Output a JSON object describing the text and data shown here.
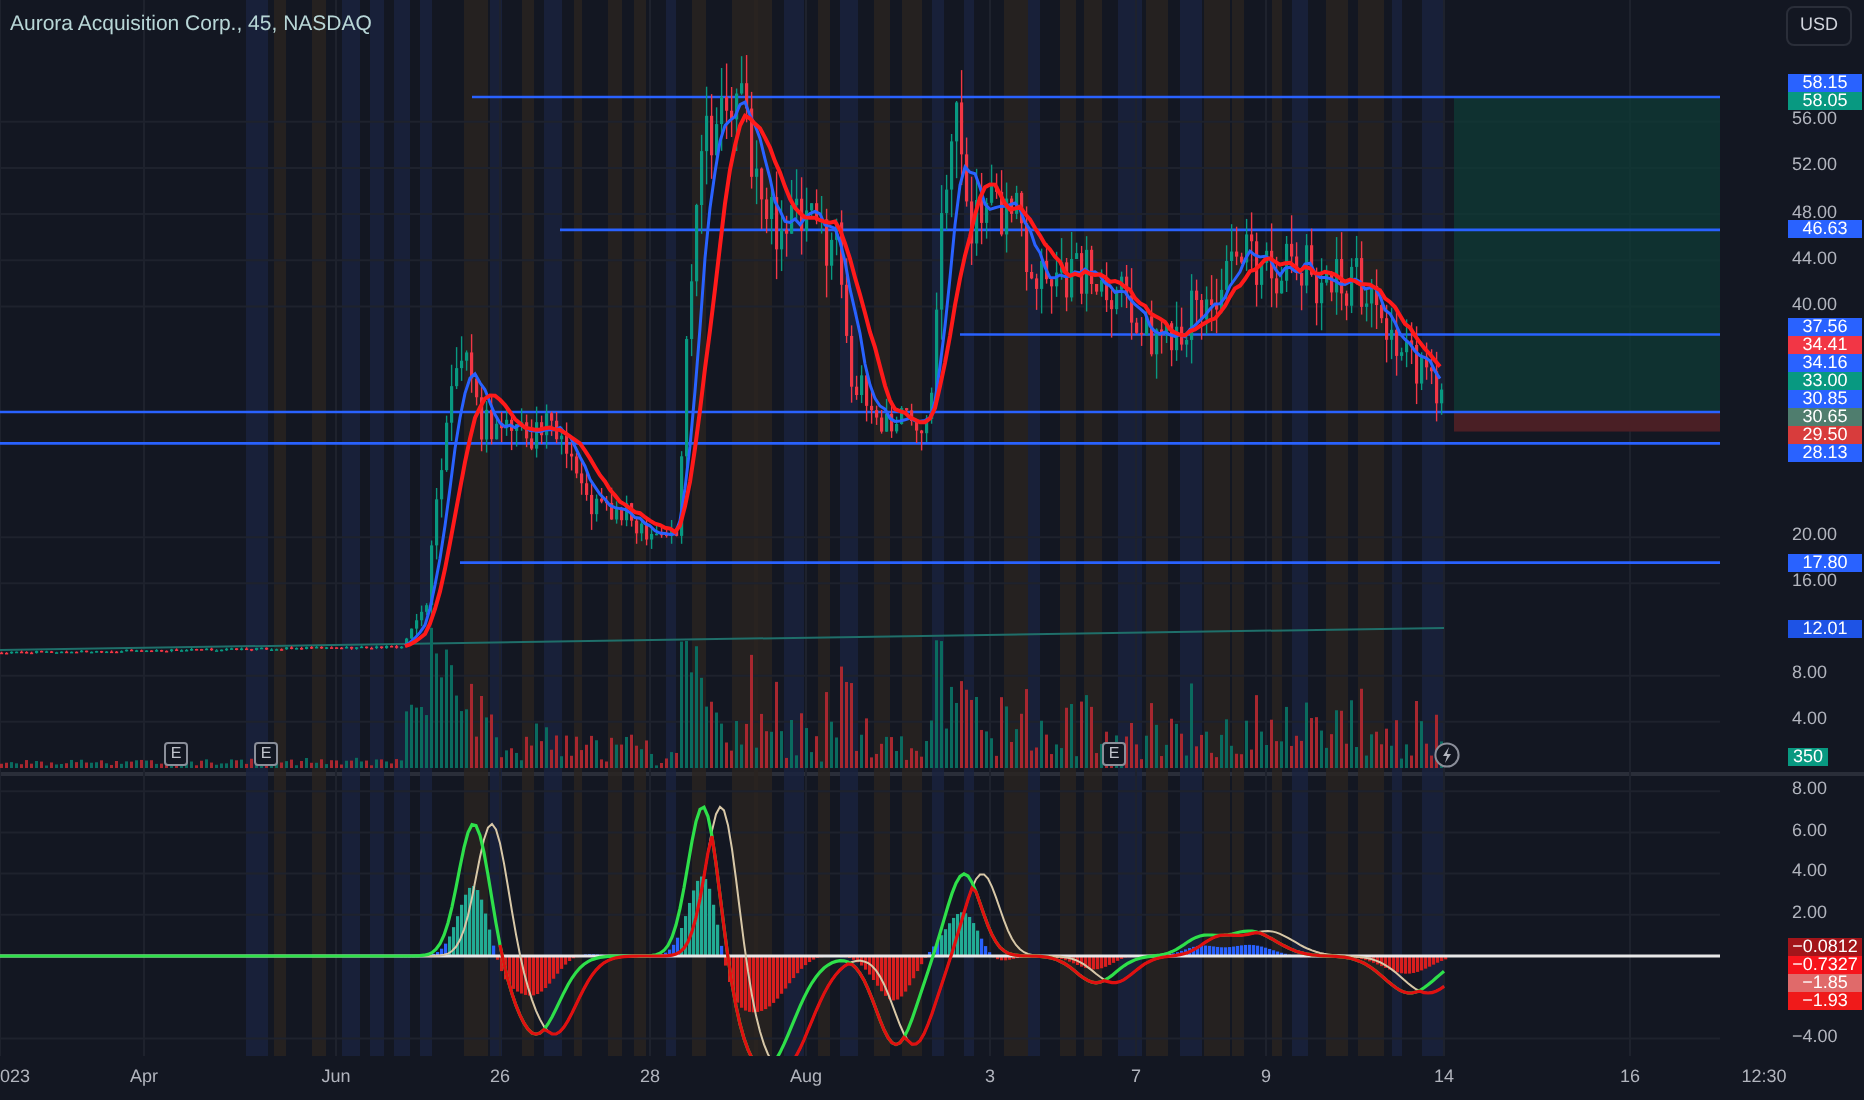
{
  "title": "Aurora Acquisition Corp., 45, NASDAQ",
  "currency_button": "USD",
  "price_axis": {
    "ticks": [
      "56.00",
      "52.00",
      "48.00",
      "44.00",
      "40.00",
      "20.00",
      "16.00",
      "8.00",
      "4.00"
    ],
    "badges": [
      {
        "text": "58.15",
        "color": "#2962ff"
      },
      {
        "text": "58.05",
        "color": "#089981"
      },
      {
        "text": "46.63",
        "color": "#2962ff"
      },
      {
        "text": "37.56",
        "color": "#2962ff"
      },
      {
        "text": "34.41",
        "color": "#f23645"
      },
      {
        "text": "34.16",
        "color": "#2962ff"
      },
      {
        "text": "33.00",
        "color": "#089981"
      },
      {
        "text": "30.85",
        "color": "#2962ff"
      },
      {
        "text": "30.65",
        "color": "#4f7d6e"
      },
      {
        "text": "29.50",
        "color": "#d83c3c"
      },
      {
        "text": "28.13",
        "color": "#2962ff"
      },
      {
        "text": "17.80",
        "color": "#2962ff"
      },
      {
        "text": "12.01",
        "color": "#1e53e5"
      }
    ]
  },
  "volume_badge": {
    "text": "350",
    "color": "#089981"
  },
  "events": [
    {
      "kind": "earnings",
      "label": "E"
    },
    {
      "kind": "earnings",
      "label": "E"
    },
    {
      "kind": "earnings",
      "label": "E"
    },
    {
      "kind": "flash"
    }
  ],
  "oscillator_axis": {
    "ticks": [
      "8.00",
      "6.00",
      "4.00",
      "2.00",
      "−4.00"
    ],
    "badges": [
      {
        "text": "−0.0812",
        "color": "#a3151a"
      },
      {
        "text": "−0.7327",
        "color": "#f7141c"
      },
      {
        "text": "−1.85",
        "color": "#e06a6a"
      },
      {
        "text": "−1.93",
        "color": "#f01a1a"
      }
    ]
  },
  "time_axis": [
    "023",
    "Apr",
    "Jun",
    "26",
    "28",
    "Aug",
    "3",
    "7",
    "9",
    "14",
    "16",
    "12:30"
  ]
}
